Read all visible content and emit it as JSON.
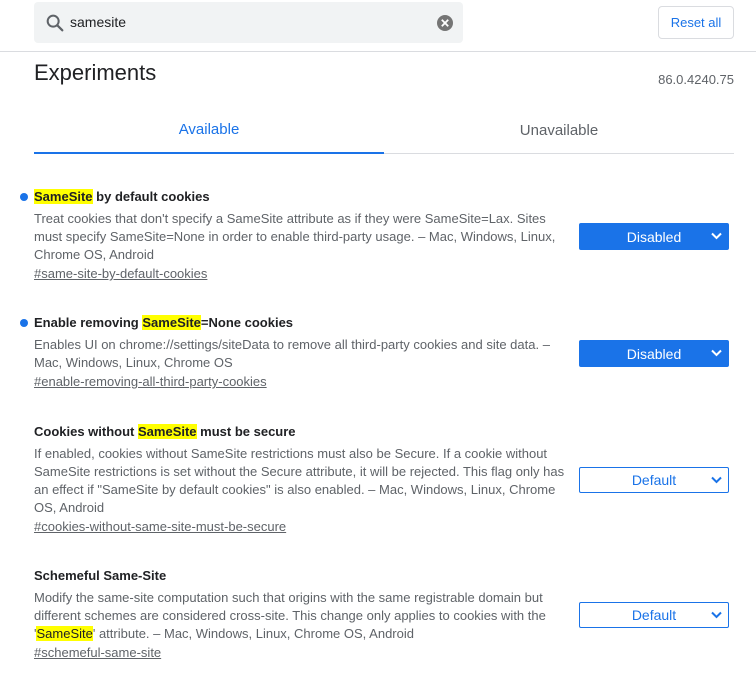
{
  "search": {
    "value": "samesite"
  },
  "header": {
    "reset_label": "Reset all"
  },
  "page": {
    "title": "Experiments",
    "version": "86.0.4240.75"
  },
  "tabs": [
    {
      "label": "Available",
      "active": true
    },
    {
      "label": "Unavailable",
      "active": false
    }
  ],
  "experiments": [
    {
      "title_pre": "",
      "title_hl": "SameSite",
      "title_post": " by default cookies",
      "modified": true,
      "desc_pre": "Treat cookies that don't specify a SameSite attribute as if they were SameSite=Lax. Sites must specify SameSite=None in order to enable third-party usage. – Mac, Windows, Linux, Chrome OS, Android",
      "desc_hl": "",
      "desc_post": "",
      "link": "#same-site-by-default-cookies",
      "select_value": "Disabled"
    },
    {
      "title_pre": "Enable removing ",
      "title_hl": "SameSite",
      "title_post": "=None cookies",
      "modified": true,
      "desc_pre": "Enables UI on chrome://settings/siteData to remove all third-party cookies and site data. – Mac, Windows, Linux, Chrome OS",
      "desc_hl": "",
      "desc_post": "",
      "link": "#enable-removing-all-third-party-cookies",
      "select_value": "Disabled"
    },
    {
      "title_pre": "Cookies without ",
      "title_hl": "SameSite",
      "title_post": " must be secure",
      "modified": false,
      "desc_pre": "If enabled, cookies without SameSite restrictions must also be Secure. If a cookie without SameSite restrictions is set without the Secure attribute, it will be rejected. This flag only has an effect if \"SameSite by default cookies\" is also enabled. – Mac, Windows, Linux, Chrome OS, Android",
      "desc_hl": "",
      "desc_post": "",
      "link": "#cookies-without-same-site-must-be-secure",
      "select_value": "Default"
    },
    {
      "title_pre": "Schemeful Same-Site",
      "title_hl": "",
      "title_post": "",
      "modified": false,
      "desc_pre": "Modify the same-site computation such that origins with the same registrable domain but different schemes are considered cross-site. This change only applies to cookies with the '",
      "desc_hl": "SameSite",
      "desc_post": "' attribute. – Mac, Windows, Linux, Chrome OS, Android",
      "link": "#schemeful-same-site",
      "select_value": "Default"
    }
  ],
  "colors": {
    "accent": "#1a73e8",
    "highlight": "#ffff00",
    "text": "#202124",
    "secondary": "#5f6368"
  },
  "icons": {
    "search": "search-icon",
    "clear": "clear-icon",
    "chevron": "chevron-down-icon"
  }
}
